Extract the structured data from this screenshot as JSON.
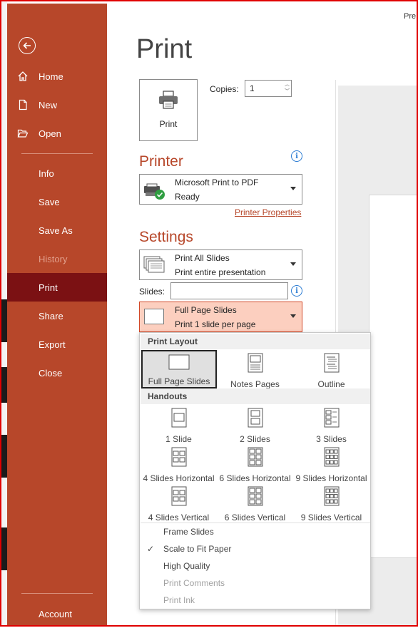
{
  "sidebar": {
    "back_icon": "back-arrow-icon",
    "items": [
      {
        "label": "Home",
        "icon": "home-icon"
      },
      {
        "label": "New",
        "icon": "new-document-icon"
      },
      {
        "label": "Open",
        "icon": "folder-open-icon"
      },
      {
        "label": "Info"
      },
      {
        "label": "Save"
      },
      {
        "label": "Save As"
      },
      {
        "label": "History",
        "disabled": true
      },
      {
        "label": "Print",
        "active": true
      },
      {
        "label": "Share"
      },
      {
        "label": "Export"
      },
      {
        "label": "Close"
      },
      {
        "label": "Account"
      }
    ]
  },
  "main": {
    "title": "Print",
    "print_button_label": "Print",
    "copies_label": "Copies:",
    "copies_value": "1",
    "printer_heading": "Printer",
    "printer": {
      "name": "Microsoft Print to PDF",
      "status": "Ready"
    },
    "printer_properties_link": "Printer Properties",
    "settings_heading": "Settings",
    "range": {
      "line1": "Print All Slides",
      "line2": "Print entire presentation"
    },
    "slides_label": "Slides:",
    "slides_value": "",
    "layout": {
      "line1": "Full Page Slides",
      "line2": "Print 1 slide per page"
    }
  },
  "preview": {
    "label": "Pre"
  },
  "menu": {
    "print_layout_heading": "Print Layout",
    "print_layout": [
      "Full Page Slides",
      "Notes Pages",
      "Outline"
    ],
    "handouts_heading": "Handouts",
    "handouts": [
      "1 Slide",
      "2 Slides",
      "3 Slides",
      "4 Slides Horizontal",
      "6 Slides Horizontal",
      "9 Slides Horizontal",
      "4 Slides Vertical",
      "6 Slides Vertical",
      "9 Slides Vertical"
    ],
    "options": {
      "frame": "Frame Slides",
      "scale": "Scale to Fit Paper",
      "quality": "High Quality",
      "comments": "Print Comments",
      "ink": "Print Ink"
    },
    "checkmark": "✓"
  },
  "colors": {
    "accent": "#b7472a",
    "active_nav": "#7b1113",
    "selected_dropdown": "#fccfbf",
    "info_blue": "#2b7cd3"
  }
}
